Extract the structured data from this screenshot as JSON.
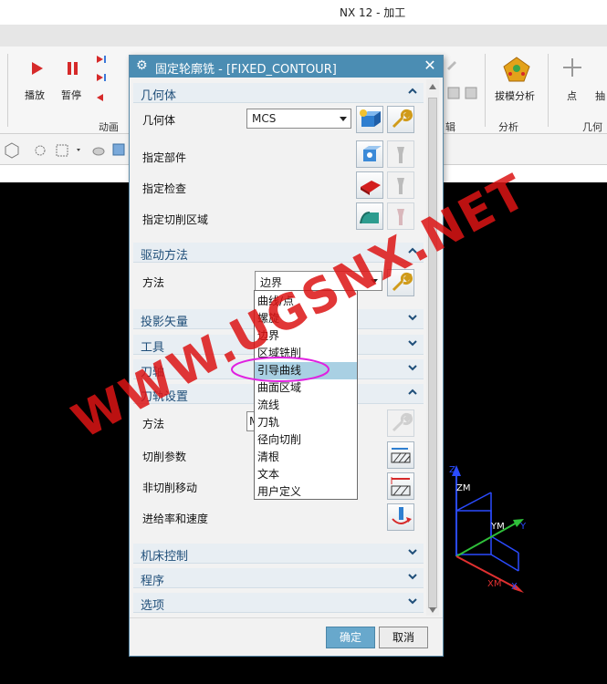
{
  "app": {
    "title": "NX 12 - 加工"
  },
  "ribbon": {
    "play_label": "播放",
    "pause_label": "暂停",
    "animation_group": "动画",
    "edit_group_fragment": "辑",
    "draft_analysis_label": "拔模分析",
    "analysis_group": "分析",
    "point_label": "点",
    "extract_fragment": "抽",
    "geometry_fragment": "几何",
    "colors": {
      "play": "#d62a2a",
      "pause": "#d62a2a",
      "accent": "#3b78d8"
    }
  },
  "dialog": {
    "title": "固定轮廓铣 - [FIXED_CONTOUR]",
    "geometry": {
      "header": "几何体",
      "geom_label": "几何体",
      "geom_value": "MCS",
      "part_label": "指定部件",
      "check_label": "指定检查",
      "cut_area_label": "指定切削区域"
    },
    "drive": {
      "header": "驱动方法",
      "method_label": "方法",
      "method_value": "边界"
    },
    "projection": {
      "header": "投影矢量"
    },
    "tool": {
      "header": "工具"
    },
    "axis": {
      "header": "刀轴"
    },
    "toolpath": {
      "header": "刀轨设置",
      "method_label": "方法",
      "method_value_fragment": "M",
      "cut_params_label": "切削参数",
      "noncut_label": "非切削移动",
      "feeds_label": "进给率和速度"
    },
    "machine": {
      "header": "机床控制"
    },
    "program": {
      "header": "程序"
    },
    "options": {
      "header": "选项"
    },
    "ok_label": "确定",
    "cancel_label": "取消",
    "colors": {
      "title_bar": "#4b8db3",
      "section_text": "#1f4e79",
      "selected_item": "#a9d0e3"
    }
  },
  "dropdown": {
    "items": [
      "曲线/点",
      "螺旋",
      "边界",
      "区域铣削",
      "引导曲线",
      "曲面区域",
      "流线",
      "刀轨",
      "径向切削",
      "清根",
      "文本",
      "用户定义"
    ],
    "selected": "引导曲线",
    "highlight_color": "#e020e0"
  },
  "axes": {
    "zm": "ZM",
    "ym": "YM",
    "xm": "XM",
    "z": "Z",
    "y": "Y",
    "x": "X"
  },
  "watermark": {
    "text": "WWW.UGSNX.NET"
  }
}
